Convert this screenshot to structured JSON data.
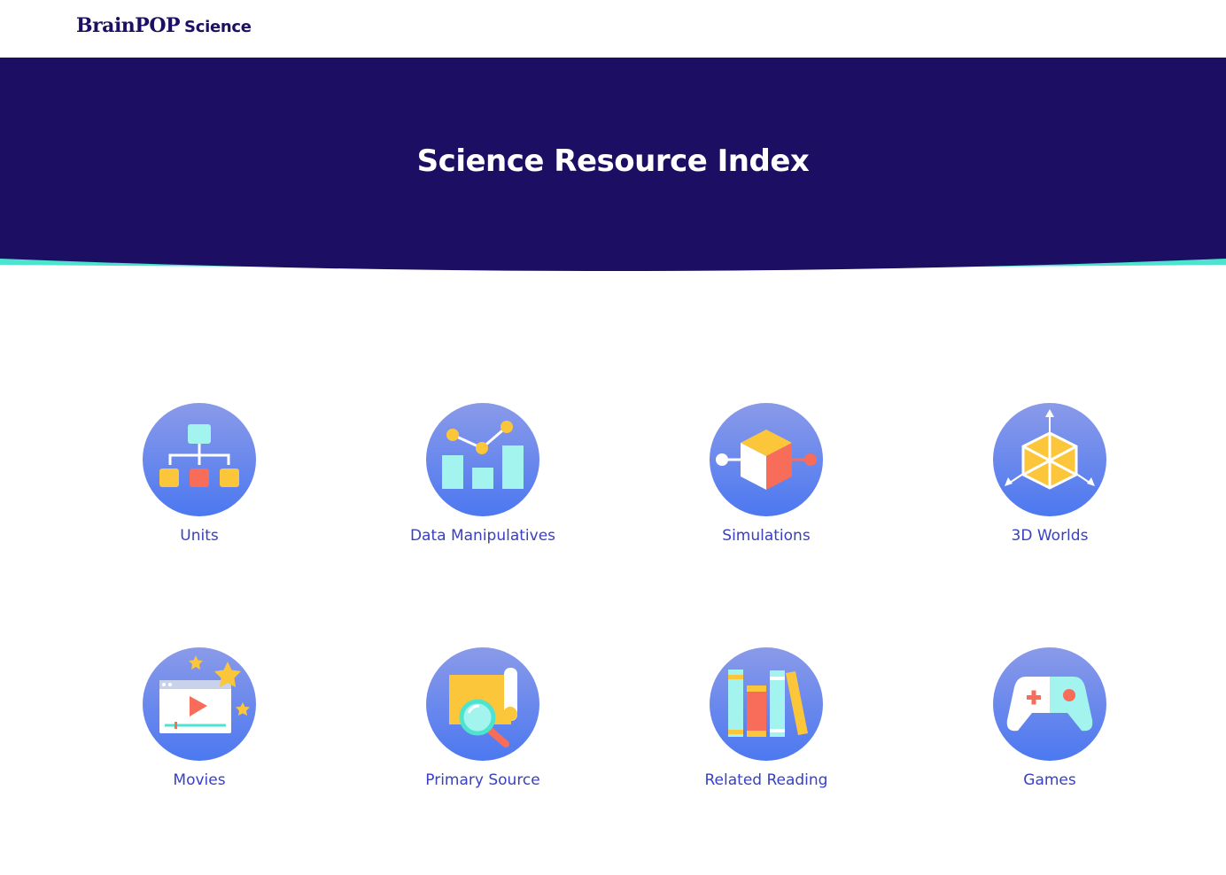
{
  "header": {
    "logo_main": "BrainPOP",
    "logo_sub": "Science"
  },
  "hero": {
    "title": "Science Resource Index"
  },
  "colors": {
    "navy": "#1c0f63",
    "teal": "#4de3cf",
    "circle_top": "#8a9ae9",
    "circle_bottom": "#4c78f0",
    "label": "#3940c2",
    "yellow": "#fcc63a",
    "coral": "#f86c5a",
    "aqua": "#a3f3ef"
  },
  "resources": [
    {
      "label": "Units",
      "icon": "units-icon"
    },
    {
      "label": "Data Manipulatives",
      "icon": "data-manipulatives-icon"
    },
    {
      "label": "Simulations",
      "icon": "simulations-icon"
    },
    {
      "label": "3D Worlds",
      "icon": "3d-worlds-icon"
    },
    {
      "label": "Movies",
      "icon": "movies-icon"
    },
    {
      "label": "Primary Source",
      "icon": "primary-source-icon"
    },
    {
      "label": "Related Reading",
      "icon": "related-reading-icon"
    },
    {
      "label": "Games",
      "icon": "games-icon"
    }
  ]
}
